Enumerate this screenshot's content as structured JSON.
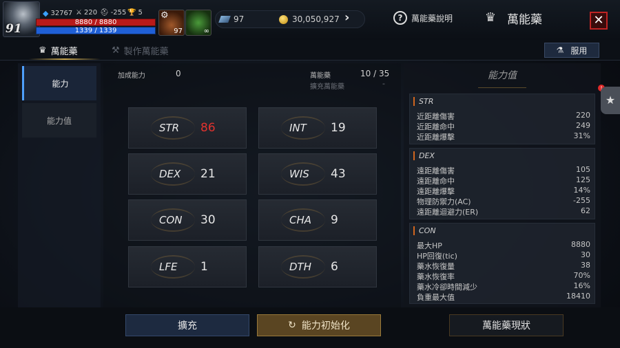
{
  "player": {
    "level": "91",
    "mp_small": "32767",
    "attack": "220",
    "defense": "-255",
    "trophy": "5",
    "hp": "8880 / 8880",
    "mp": "1339 / 1339"
  },
  "slots": [
    {
      "count": "97"
    },
    {
      "count": "∞"
    }
  ],
  "currency": {
    "gems": "97",
    "gold": "30,050,927"
  },
  "header": {
    "help_label": "萬能藥說明",
    "title": "萬能藥",
    "close": "✕"
  },
  "tabs": [
    {
      "label": "萬能藥"
    },
    {
      "label": "製作萬能藥"
    }
  ],
  "use_button": "服用",
  "sidenav": [
    {
      "label": "能力"
    },
    {
      "label": "能力值"
    }
  ],
  "summary": {
    "bonus_label": "加成能力",
    "bonus_value": "0",
    "potion_label": "萬能藥",
    "potion_value": "10 / 35",
    "expand_label": "擴充萬能藥",
    "expand_value": "-"
  },
  "stats": [
    {
      "name": "STR",
      "value": "86",
      "highlight": true
    },
    {
      "name": "INT",
      "value": "19"
    },
    {
      "name": "DEX",
      "value": "21"
    },
    {
      "name": "WIS",
      "value": "43"
    },
    {
      "name": "CON",
      "value": "30"
    },
    {
      "name": "CHA",
      "value": "9"
    },
    {
      "name": "LFE",
      "value": "1"
    },
    {
      "name": "DTH",
      "value": "6"
    }
  ],
  "right_panel": {
    "title": "能力值",
    "groups": [
      {
        "title": "STR",
        "rows": [
          {
            "label": "近距離傷害",
            "value": "220"
          },
          {
            "label": "近距離命中",
            "value": "249"
          },
          {
            "label": "近距離爆擊",
            "value": "31%"
          }
        ]
      },
      {
        "title": "DEX",
        "rows": [
          {
            "label": "遠距離傷害",
            "value": "105"
          },
          {
            "label": "遠距離命中",
            "value": "125"
          },
          {
            "label": "遠距離爆擊",
            "value": "14%"
          },
          {
            "label": "物理防禦力(AC)",
            "value": "-255"
          },
          {
            "label": "遠距離迴避力(ER)",
            "value": "62"
          }
        ]
      },
      {
        "title": "CON",
        "rows": [
          {
            "label": "最大HP",
            "value": "8880"
          },
          {
            "label": "HP回復(tic)",
            "value": "30"
          },
          {
            "label": "藥水恢復量",
            "value": "38"
          },
          {
            "label": "藥水恢復率",
            "value": "70%"
          },
          {
            "label": "藥水冷卻時間減少",
            "value": "16%"
          },
          {
            "label": "負重最大值",
            "value": "18410"
          }
        ]
      }
    ]
  },
  "bottom": {
    "expand": "擴充",
    "reset": "能力初始化",
    "status": "萬能藥現狀"
  },
  "colors": {
    "highlight_red": "#e0322e",
    "accent_blue": "#4ea0ff",
    "close_red": "#c02424"
  }
}
